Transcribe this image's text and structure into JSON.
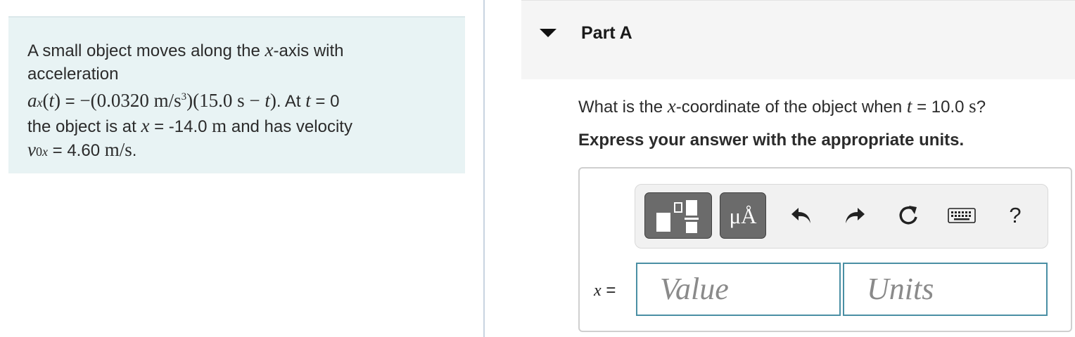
{
  "problem": {
    "line1": "A small object moves along the ",
    "line1_var": "x",
    "line1_end": "-axis with",
    "line2": "acceleration",
    "equation": "ax(t) = −(0.0320 m/s³)(15.0 s − t). At t = 0",
    "line4": "the object is at x = -14.0 m and has velocity",
    "line5": "v0x = 4.60 m/s."
  },
  "part": {
    "title": "Part A"
  },
  "question": {
    "text_before": "What is the ",
    "var_x": "x",
    "text_mid": "-coordinate of the object when ",
    "var_t": "t",
    "text_end": " = 10.0 s?"
  },
  "instruction": "Express your answer with the appropriate units.",
  "toolbar": {
    "units_label": "μÅ",
    "help_label": "?",
    "icons": [
      "templates-icon",
      "undo-icon",
      "redo-icon",
      "reset-icon",
      "keyboard-icon"
    ]
  },
  "answer": {
    "variable_label": "x =",
    "value_placeholder": "Value",
    "units_placeholder": "Units"
  },
  "colors": {
    "panel_bg": "#e8f3f4",
    "input_border": "#4a8fa4",
    "toolbar_btn": "#6b6b6b"
  }
}
